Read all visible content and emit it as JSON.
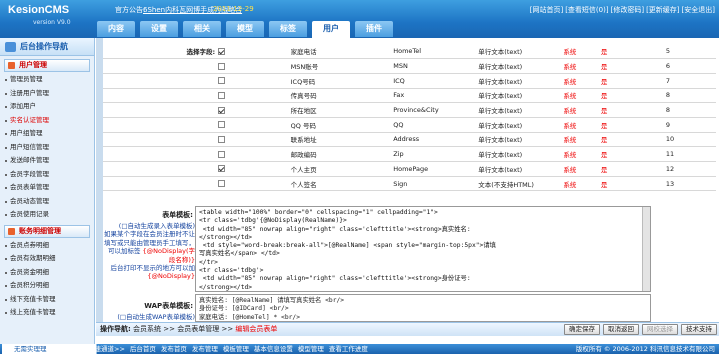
{
  "app": {
    "logo": "KesionCMS",
    "version": "version V9.0"
  },
  "announce": {
    "label": "官方公告:",
    "link": "6Shen内科瓦网博手成为战略合",
    "date": "2011-12-29"
  },
  "toplinks": [
    "[网站首页]",
    "[查看短信(0)]",
    "[修改密码]",
    "[更新缓存]",
    "[安全退出]"
  ],
  "tabs": [
    "内容",
    "设置",
    "相关",
    "模型",
    "标签",
    "用户",
    "插件"
  ],
  "active_tab": 5,
  "sidebar": {
    "title": "后台操作导航",
    "sections": [
      {
        "title": "用户管理",
        "items": [
          "管理员管理",
          "注册用户管理",
          "添加用户",
          "实名认证管理",
          "用户组管理",
          "用户短信管理",
          "发送邮件管理",
          "会员字段管理",
          "会员表单管理",
          "会员动态管理",
          "会员使用记录"
        ]
      },
      {
        "title": "账务明细管理",
        "items": [
          "会员点券明细",
          "会员有效期明细",
          "会员资金明细",
          "会员积分明细",
          "线下充值卡管理",
          "线上充值卡管理"
        ]
      }
    ],
    "red_item": "实名认证管理"
  },
  "fields": {
    "label": "选择字段:",
    "rows": [
      {
        "checked": true,
        "name": "家庭电话",
        "field": "HomeTel",
        "type": "单行文本(text)",
        "src": "系统",
        "req": "是",
        "order": "5"
      },
      {
        "checked": false,
        "name": "MSN账号",
        "field": "MSN",
        "type": "单行文本(text)",
        "src": "系统",
        "req": "是",
        "order": "6"
      },
      {
        "checked": false,
        "name": "ICQ号码",
        "field": "ICQ",
        "type": "单行文本(text)",
        "src": "系统",
        "req": "是",
        "order": "7"
      },
      {
        "checked": false,
        "name": "传真号码",
        "field": "Fax",
        "type": "单行文本(text)",
        "src": "系统",
        "req": "是",
        "order": "8"
      },
      {
        "checked": true,
        "name": "所在地区",
        "field": "Province&City",
        "type": "单行文本(text)",
        "src": "系统",
        "req": "是",
        "order": "8"
      },
      {
        "checked": false,
        "name": "QQ 号码",
        "field": "QQ",
        "type": "单行文本(text)",
        "src": "系统",
        "req": "是",
        "order": "9"
      },
      {
        "checked": false,
        "name": "联系地址",
        "field": "Address",
        "type": "单行文本(text)",
        "src": "系统",
        "req": "是",
        "order": "10"
      },
      {
        "checked": false,
        "name": "邮政编码",
        "field": "Zip",
        "type": "单行文本(text)",
        "src": "系统",
        "req": "是",
        "order": "11"
      },
      {
        "checked": true,
        "name": "个人主页",
        "field": "HomePage",
        "type": "单行文本(text)",
        "src": "系统",
        "req": "是",
        "order": "12"
      },
      {
        "checked": false,
        "name": "个人签名",
        "field": "Sign",
        "type": "文本(不支持HTML)",
        "src": "系统",
        "req": "是",
        "order": "13"
      }
    ]
  },
  "form_template": {
    "label": "表单模板:",
    "note_auto": "(□自动生成录入表单模板)",
    "note_1": "如果某个字段在会员注册时不让填写或只能由管理员手工填写，可以加标签",
    "note_tag1": "{@NoDisplay(字段名称)}",
    "note_2": "后台打印不显示的地方可以加",
    "note_tag2": "{@NoDisplay}",
    "content": "<table width=\"100%\" border=\"0\" cellspacing=\"1\" cellpadding=\"1\">\n<tr class='tdbg'{@NoDisplay(RealName)}>\n <td width=\"85\" nowrap align=\"right\" class='clefttitle'><strong>真实姓名:\n</strong></td>\n <td style=\"word-break:break-all\">[@RealName] <span style=\"margin-top:5px\">请填\n写真实姓名</span> </td>\n</tr>\n<tr class='tdbg'>\n <td width=\"85\" nowrap align=\"right\" class='clefttitle'><strong>身份证号:\n</strong></td>"
  },
  "wap_template": {
    "label": "WAP表单模板:",
    "note": "(□自动生成WAP表单模板)",
    "content": "真实姓名: [@RealName] 请填写真实姓名 <br/>\n身份证号: [@IDCard] <br/>\n家庭电话: [@HomeTel] * <br/>"
  },
  "opbar": {
    "label": "操作导航:",
    "crumb": "会员系统 >> 会员表单管理 >>",
    "current": "编辑会员表单",
    "buttons": [
      "确定保存",
      "取消返回",
      "网校选择",
      "技术支持"
    ]
  },
  "statusbar": {
    "left": "无需实理理",
    "nav": [
      "快速通道>>",
      "后台首页",
      "发布首页",
      "发布管理",
      "模板管理",
      "基本信息设置",
      "模型管理",
      "查看工作进度"
    ],
    "copyright": "版权所有 © 2006-2012 科汛信息技术有限公司"
  }
}
